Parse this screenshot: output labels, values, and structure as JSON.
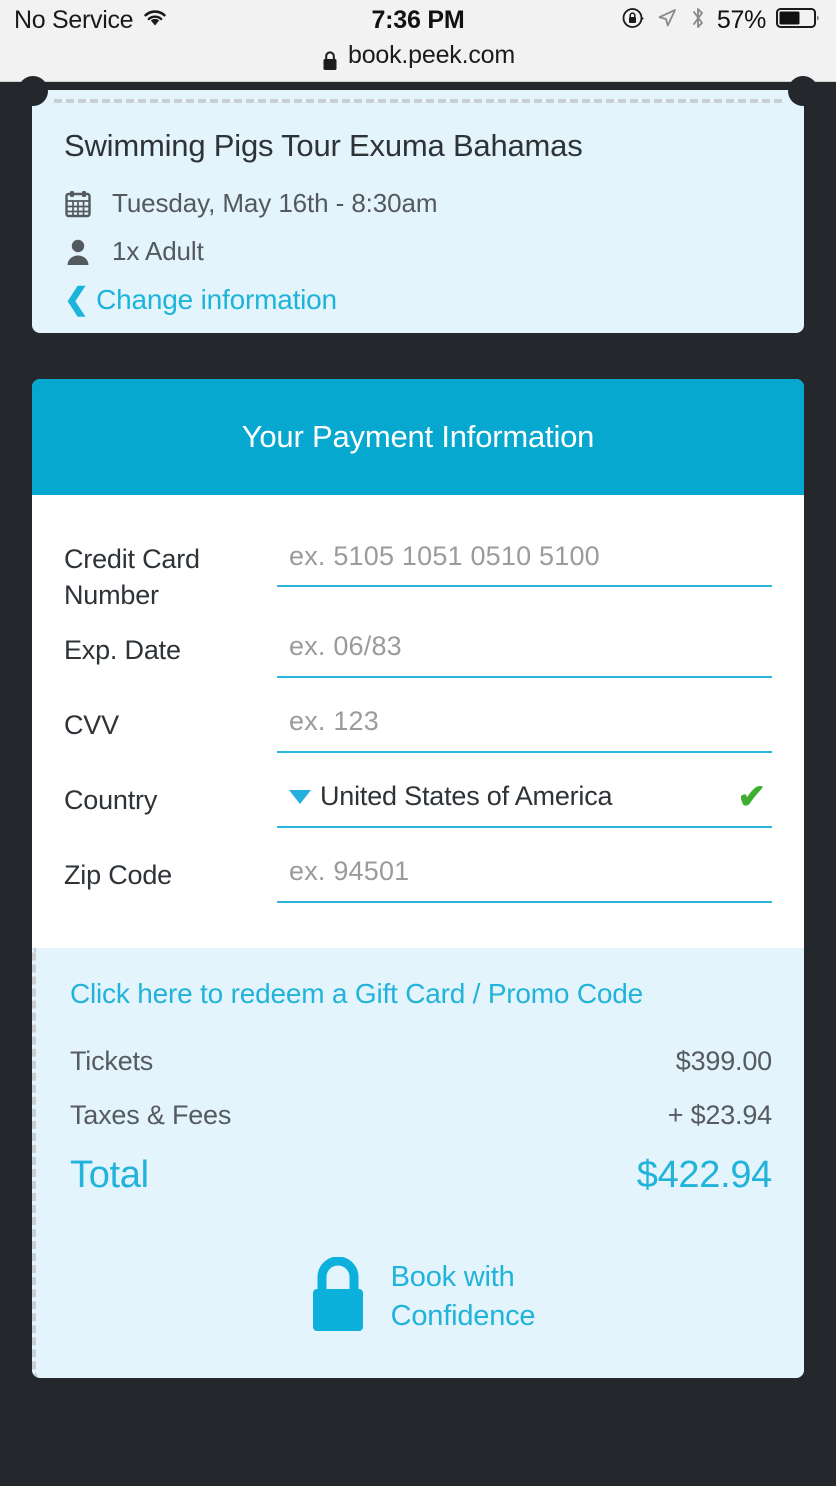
{
  "statusbar": {
    "carrier": "No Service",
    "wifi_icon": "wifi-icon",
    "time": "7:36 PM",
    "rotation_lock_icon": "rotation-lock-icon",
    "location_icon": "location-arrow-icon",
    "bluetooth_icon": "bluetooth-icon",
    "battery_percent": "57%",
    "battery_icon": "battery-icon",
    "battery_level": 57
  },
  "urlbar": {
    "lock_icon": "lock-icon",
    "url": "book.peek.com"
  },
  "tour_card": {
    "title": "Swimming Pigs Tour Exuma Bahamas",
    "date_icon": "calendar-icon",
    "date": "Tuesday, May 16th - 8:30am",
    "guests_icon": "person-icon",
    "guests": "1x Adult",
    "change_icon": "chevron-left-icon",
    "change_label": "Change information"
  },
  "payment": {
    "header": "Your Payment Information",
    "fields": [
      {
        "label": "Credit Card Number",
        "placeholder": "ex. 5105 1051 0510 5100",
        "value": "",
        "type": "input"
      },
      {
        "label": "Exp. Date",
        "placeholder": "ex. 06/83",
        "value": "",
        "type": "input"
      },
      {
        "label": "CVV",
        "placeholder": "ex. 123",
        "value": "",
        "type": "input"
      },
      {
        "label": "Country",
        "placeholder": "",
        "value": "United States of America",
        "type": "select",
        "valid": true
      },
      {
        "label": "Zip Code",
        "placeholder": "ex. 94501",
        "value": "",
        "type": "input"
      }
    ],
    "select_caret_icon": "chevron-down-icon",
    "valid_icon": "checkmark-icon"
  },
  "summary": {
    "promo_link": "Click here to redeem a Gift Card / Promo Code",
    "lines": [
      {
        "label": "Tickets",
        "value": "$399.00"
      },
      {
        "label": "Taxes & Fees",
        "value": "+  $23.94"
      }
    ],
    "total_label": "Total",
    "total_value": "$422.94",
    "confidence_icon": "padlock-icon",
    "confidence_line1": "Book with",
    "confidence_line2": "Confidence"
  },
  "colors": {
    "accent_cyan": "#06a8cf",
    "link_cyan": "#22b3da",
    "field_underline": "#2bb5d9",
    "card_light_blue": "#e3f4fc",
    "page_background": "#24272b",
    "valid_green": "#3eae31"
  }
}
